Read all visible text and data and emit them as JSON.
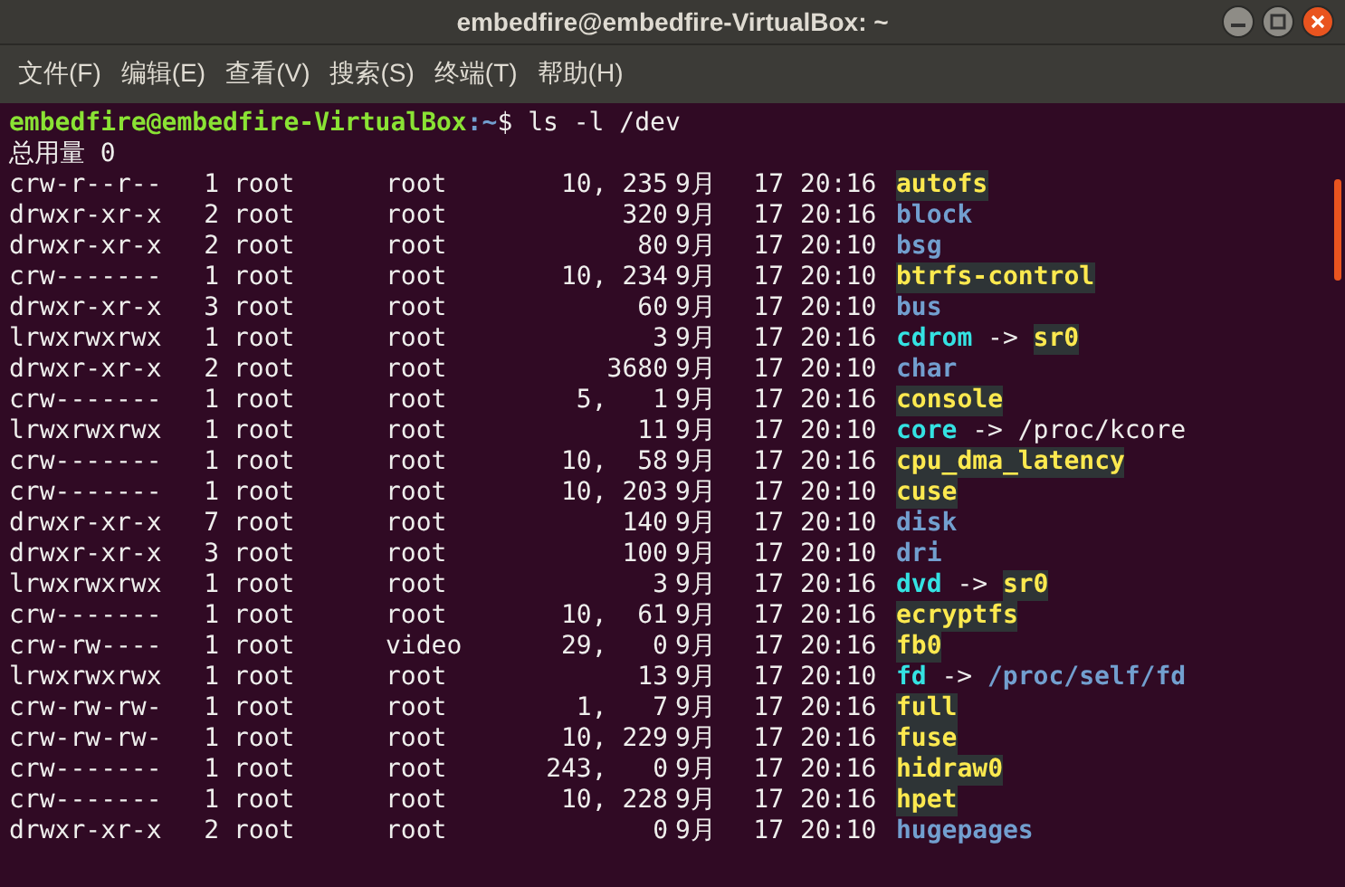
{
  "window": {
    "title": "embedfire@embedfire-VirtualBox: ~"
  },
  "menu": [
    "文件(F)",
    "编辑(E)",
    "查看(V)",
    "搜索(S)",
    "终端(T)",
    "帮助(H)"
  ],
  "prompt": {
    "user_host": "embedfire@embedfire-VirtualBox",
    "path": ":~",
    "symbol": "$",
    "command": "ls -l /dev"
  },
  "total": "总用量 0",
  "rows": [
    {
      "perms": "crw-r--r--",
      "links": "1",
      "owner": "root",
      "group": "root",
      "size": "10, 235",
      "month": "9月",
      "day": "17",
      "time": "20:16",
      "name": "autofs",
      "kind": "device"
    },
    {
      "perms": "drwxr-xr-x",
      "links": "2",
      "owner": "root",
      "group": "root",
      "size": "320",
      "month": "9月",
      "day": "17",
      "time": "20:16",
      "name": "block",
      "kind": "dir"
    },
    {
      "perms": "drwxr-xr-x",
      "links": "2",
      "owner": "root",
      "group": "root",
      "size": "80",
      "month": "9月",
      "day": "17",
      "time": "20:10",
      "name": "bsg",
      "kind": "dir"
    },
    {
      "perms": "crw-------",
      "links": "1",
      "owner": "root",
      "group": "root",
      "size": "10, 234",
      "month": "9月",
      "day": "17",
      "time": "20:10",
      "name": "btrfs-control",
      "kind": "device"
    },
    {
      "perms": "drwxr-xr-x",
      "links": "3",
      "owner": "root",
      "group": "root",
      "size": "60",
      "month": "9月",
      "day": "17",
      "time": "20:10",
      "name": "bus",
      "kind": "dir"
    },
    {
      "perms": "lrwxrwxrwx",
      "links": "1",
      "owner": "root",
      "group": "root",
      "size": "3",
      "month": "9月",
      "day": "17",
      "time": "20:16",
      "name": "cdrom",
      "kind": "link",
      "arrow": "->",
      "target": {
        "text": "sr0",
        "kind": "device"
      }
    },
    {
      "perms": "drwxr-xr-x",
      "links": "2",
      "owner": "root",
      "group": "root",
      "size": "3680",
      "month": "9月",
      "day": "17",
      "time": "20:10",
      "name": "char",
      "kind": "dir"
    },
    {
      "perms": "crw-------",
      "links": "1",
      "owner": "root",
      "group": "root",
      "size": "5,   1",
      "month": "9月",
      "day": "17",
      "time": "20:16",
      "name": "console",
      "kind": "device"
    },
    {
      "perms": "lrwxrwxrwx",
      "links": "1",
      "owner": "root",
      "group": "root",
      "size": "11",
      "month": "9月",
      "day": "17",
      "time": "20:10",
      "name": "core",
      "kind": "link",
      "arrow": "->",
      "target": {
        "text": "/proc/kcore",
        "kind": "plain"
      }
    },
    {
      "perms": "crw-------",
      "links": "1",
      "owner": "root",
      "group": "root",
      "size": "10,  58",
      "month": "9月",
      "day": "17",
      "time": "20:16",
      "name": "cpu_dma_latency",
      "kind": "device"
    },
    {
      "perms": "crw-------",
      "links": "1",
      "owner": "root",
      "group": "root",
      "size": "10, 203",
      "month": "9月",
      "day": "17",
      "time": "20:10",
      "name": "cuse",
      "kind": "device"
    },
    {
      "perms": "drwxr-xr-x",
      "links": "7",
      "owner": "root",
      "group": "root",
      "size": "140",
      "month": "9月",
      "day": "17",
      "time": "20:10",
      "name": "disk",
      "kind": "dir"
    },
    {
      "perms": "drwxr-xr-x",
      "links": "3",
      "owner": "root",
      "group": "root",
      "size": "100",
      "month": "9月",
      "day": "17",
      "time": "20:10",
      "name": "dri",
      "kind": "dir"
    },
    {
      "perms": "lrwxrwxrwx",
      "links": "1",
      "owner": "root",
      "group": "root",
      "size": "3",
      "month": "9月",
      "day": "17",
      "time": "20:16",
      "name": "dvd",
      "kind": "link",
      "arrow": "->",
      "target": {
        "text": "sr0",
        "kind": "device"
      }
    },
    {
      "perms": "crw-------",
      "links": "1",
      "owner": "root",
      "group": "root",
      "size": "10,  61",
      "month": "9月",
      "day": "17",
      "time": "20:16",
      "name": "ecryptfs",
      "kind": "device"
    },
    {
      "perms": "crw-rw----",
      "links": "1",
      "owner": "root",
      "group": "video",
      "size": "29,   0",
      "month": "9月",
      "day": "17",
      "time": "20:16",
      "name": "fb0",
      "kind": "device"
    },
    {
      "perms": "lrwxrwxrwx",
      "links": "1",
      "owner": "root",
      "group": "root",
      "size": "13",
      "month": "9月",
      "day": "17",
      "time": "20:10",
      "name": "fd",
      "kind": "link",
      "arrow": "->",
      "target": {
        "text": "/proc/self/fd",
        "kind": "dir"
      }
    },
    {
      "perms": "crw-rw-rw-",
      "links": "1",
      "owner": "root",
      "group": "root",
      "size": "1,   7",
      "month": "9月",
      "day": "17",
      "time": "20:16",
      "name": "full",
      "kind": "device"
    },
    {
      "perms": "crw-rw-rw-",
      "links": "1",
      "owner": "root",
      "group": "root",
      "size": "10, 229",
      "month": "9月",
      "day": "17",
      "time": "20:16",
      "name": "fuse",
      "kind": "device"
    },
    {
      "perms": "crw-------",
      "links": "1",
      "owner": "root",
      "group": "root",
      "size": "243,   0",
      "month": "9月",
      "day": "17",
      "time": "20:16",
      "name": "hidraw0",
      "kind": "device"
    },
    {
      "perms": "crw-------",
      "links": "1",
      "owner": "root",
      "group": "root",
      "size": "10, 228",
      "month": "9月",
      "day": "17",
      "time": "20:16",
      "name": "hpet",
      "kind": "device"
    },
    {
      "perms": "drwxr-xr-x",
      "links": "2",
      "owner": "root",
      "group": "root",
      "size": "0",
      "month": "9月",
      "day": "17",
      "time": "20:10",
      "name": "hugepages",
      "kind": "dir"
    }
  ]
}
